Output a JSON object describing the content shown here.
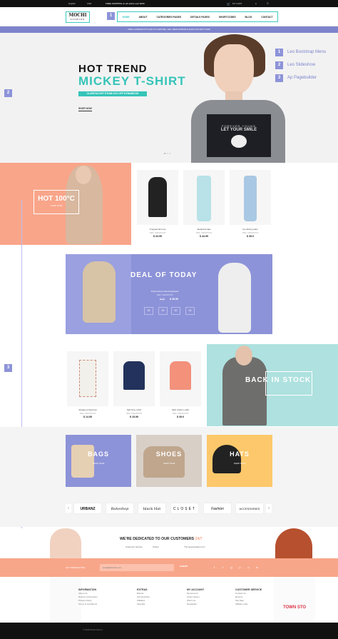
{
  "topbar": {
    "language": "English",
    "currency": "USD",
    "shipping": "FREE SHIPPING on all orders over $150",
    "cart": "MY CART"
  },
  "logo": {
    "name": "MOCHI",
    "tagline": "FASHION"
  },
  "badges": [
    "1",
    "2",
    "3"
  ],
  "nav": [
    {
      "label": "HOME"
    },
    {
      "label": "ABOUT"
    },
    {
      "label": "CATEGORIES PAGES"
    },
    {
      "label": "DETAILS PAGES"
    },
    {
      "label": "SHORTCODES"
    },
    {
      "label": "BLOG"
    },
    {
      "label": "CONTACT"
    }
  ],
  "promo": "1000+ FASHION STYLES TO CHOOSE. 100+ NEW ARRIVALS EACH DAY.BUY NOW",
  "hero": {
    "title1": "HOT TREND",
    "title2": "MICKEY T-SHIRT",
    "subtitle": "CLARITAS EST ETIAM 10% OFF DYNAMICUS",
    "shop": "SHOP NOW",
    "tee_line1": "FOREVER YOUNG",
    "tee_line2": "LET YOUR SMILE"
  },
  "features": [
    {
      "num": "1",
      "label": "Leo Bootstrap Menu"
    },
    {
      "num": "2",
      "label": "Leo Slideshow"
    },
    {
      "num": "3",
      "label": "Ap Pagebuilder"
    }
  ],
  "hot_banner": {
    "title": "HOT 100°C",
    "cta": "SHOP NOW"
  },
  "products_row1": [
    {
      "name": "Cropped lace top",
      "ref": "REF. #00087678",
      "price": "$ 34.95"
    },
    {
      "name": "Jacquard cape",
      "ref": "REF. #00087678",
      "price": "$ 44.99"
    },
    {
      "name": "Ice skinny jeans",
      "ref": "REF. #00087678",
      "price": "$ 35.0"
    }
  ],
  "deal": {
    "title": "DEAL OF TODAY",
    "desc": "Printed linen blend backpack",
    "ref": "REF. #00087678",
    "old_price": "$ 45",
    "price": "$ 39.95",
    "countdown": [
      "00",
      "00",
      "00",
      "00"
    ]
  },
  "products_row2": [
    {
      "name": "Strappy printed top",
      "ref": "REF. #00087678",
      "price": "$ 14.95"
    },
    {
      "name": "Skd Tony t-shirt",
      "ref": "REF. #00087678",
      "price": "$ 15.99"
    },
    {
      "name": "Slub Cotton t-shirt",
      "ref": "REF. #00087678",
      "price": "$ 39.0"
    }
  ],
  "stock_banner": {
    "title": "BACK IN STOCK"
  },
  "categories": [
    {
      "title": "BAGS",
      "cta": "SHOP NOW"
    },
    {
      "title": "SHOES",
      "cta": "SHOP NOW"
    },
    {
      "title": "HATS",
      "cta": "SHOP NOW"
    }
  ],
  "brands": [
    "URBANZ",
    "Bakeshop",
    "black Hat",
    "CLOSET",
    "Fashion",
    "ACCESSORIES"
  ],
  "dedicated": {
    "text": "WE'RE DEDICATED TO OUR CUSTOMERS",
    "highlight": "24/7",
    "info1": "Customer Service",
    "info2": "Online",
    "info3": "The leoexamples.com"
  },
  "newsletter": {
    "label": "GET NEWSLETTER",
    "placeholder": "email@domain.com",
    "button": "SUBMIT",
    "social": [
      "f",
      "t",
      "g",
      "p",
      "o",
      "in"
    ]
  },
  "footer_cols": [
    {
      "title": "INFORMATION",
      "items": [
        "About Us",
        "Delivery Information",
        "Privacy Policy",
        "Terms & Conditions"
      ]
    },
    {
      "title": "EXTRAS",
      "items": [
        "Brands",
        "Gift Vouchers",
        "Affiliates",
        "Specials"
      ]
    },
    {
      "title": "MY ACCOUNT",
      "items": [
        "My Account",
        "Order History",
        "Wish List",
        "Newsletter"
      ]
    },
    {
      "title": "CUSTOMER SERVICE",
      "items": [
        "Contact Us",
        "Returns",
        "Site Map",
        "Affiliate Links"
      ]
    }
  ],
  "footer_bottom": "© 2016 Mochi theme.",
  "colors": {
    "teal": "#35c4b8",
    "purple": "#8d93d8",
    "salmon": "#f9a58a",
    "yellow": "#fcc86b"
  }
}
